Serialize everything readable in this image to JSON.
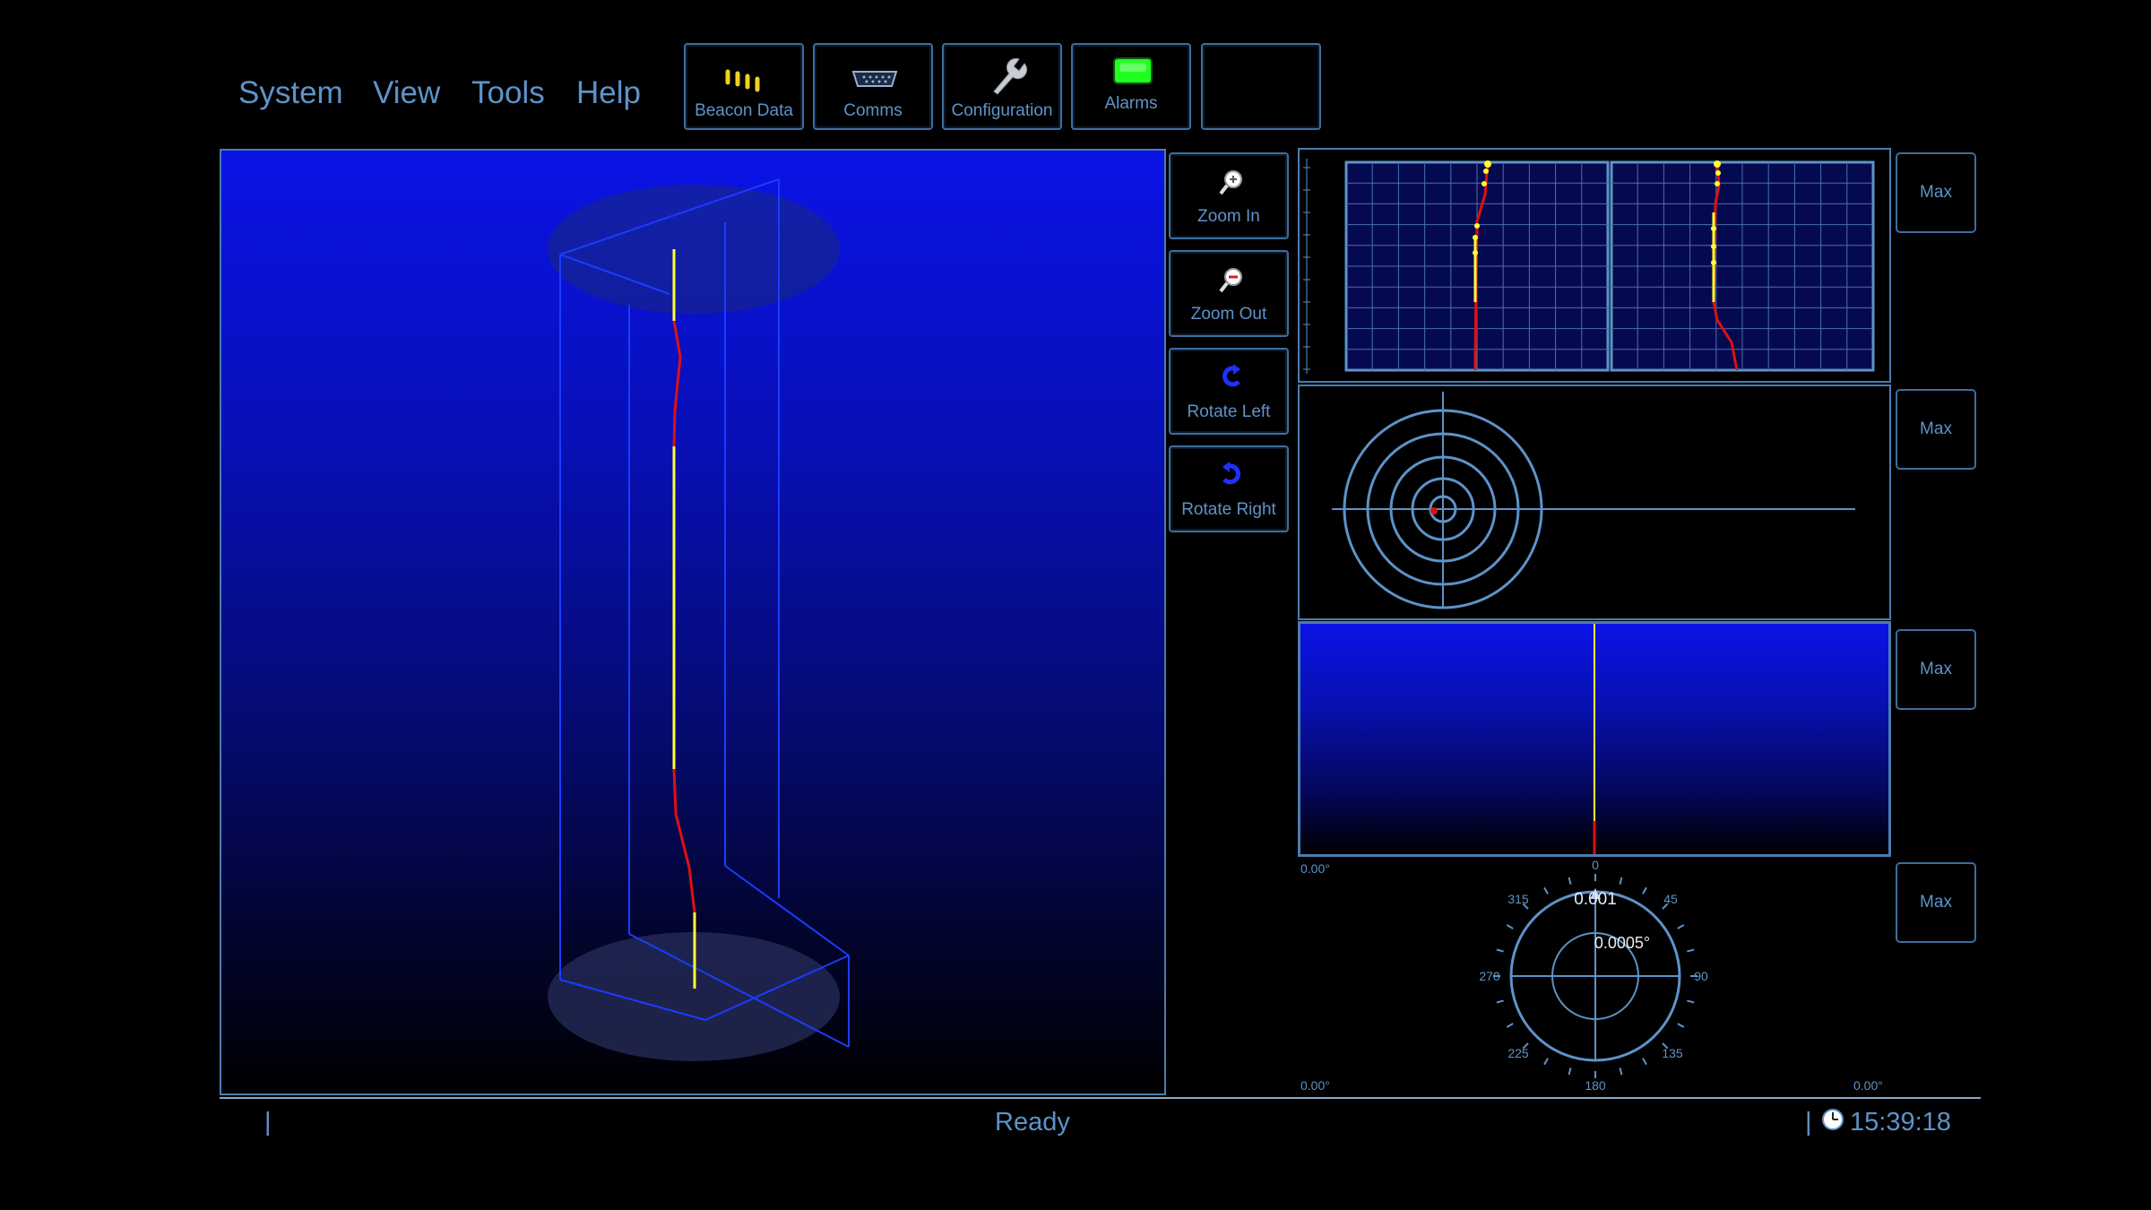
{
  "menu": {
    "items": [
      "System",
      "View",
      "Tools",
      "Help"
    ]
  },
  "toolbar": {
    "beacon_data": "Beacon Data",
    "comms": "Comms",
    "configuration": "Configuration",
    "alarms": "Alarms",
    "blank": ""
  },
  "side_buttons": {
    "zoom_in": "Zoom In",
    "zoom_out": "Zoom Out",
    "rotate_left": "Rotate Left",
    "rotate_right": "Rotate Right"
  },
  "panels": {
    "max_label": "Max",
    "gauge": {
      "left_top_value": "0.00°",
      "left_bottom_value": "0.00°",
      "right_bottom_value": "0.00°",
      "readout_1": "0.001",
      "readout_2": "0.0005°",
      "headings": [
        "0",
        "45",
        "90",
        "135",
        "180",
        "225",
        "270",
        "315"
      ]
    }
  },
  "status": {
    "separator": "|",
    "text": "Ready",
    "time": "15:39:18"
  },
  "colors": {
    "accent": "#5d93c9",
    "border": "#4a7db0",
    "riser_yellow": "#ffff33",
    "riser_red": "#e01010",
    "alarm_green": "#20ff20"
  }
}
